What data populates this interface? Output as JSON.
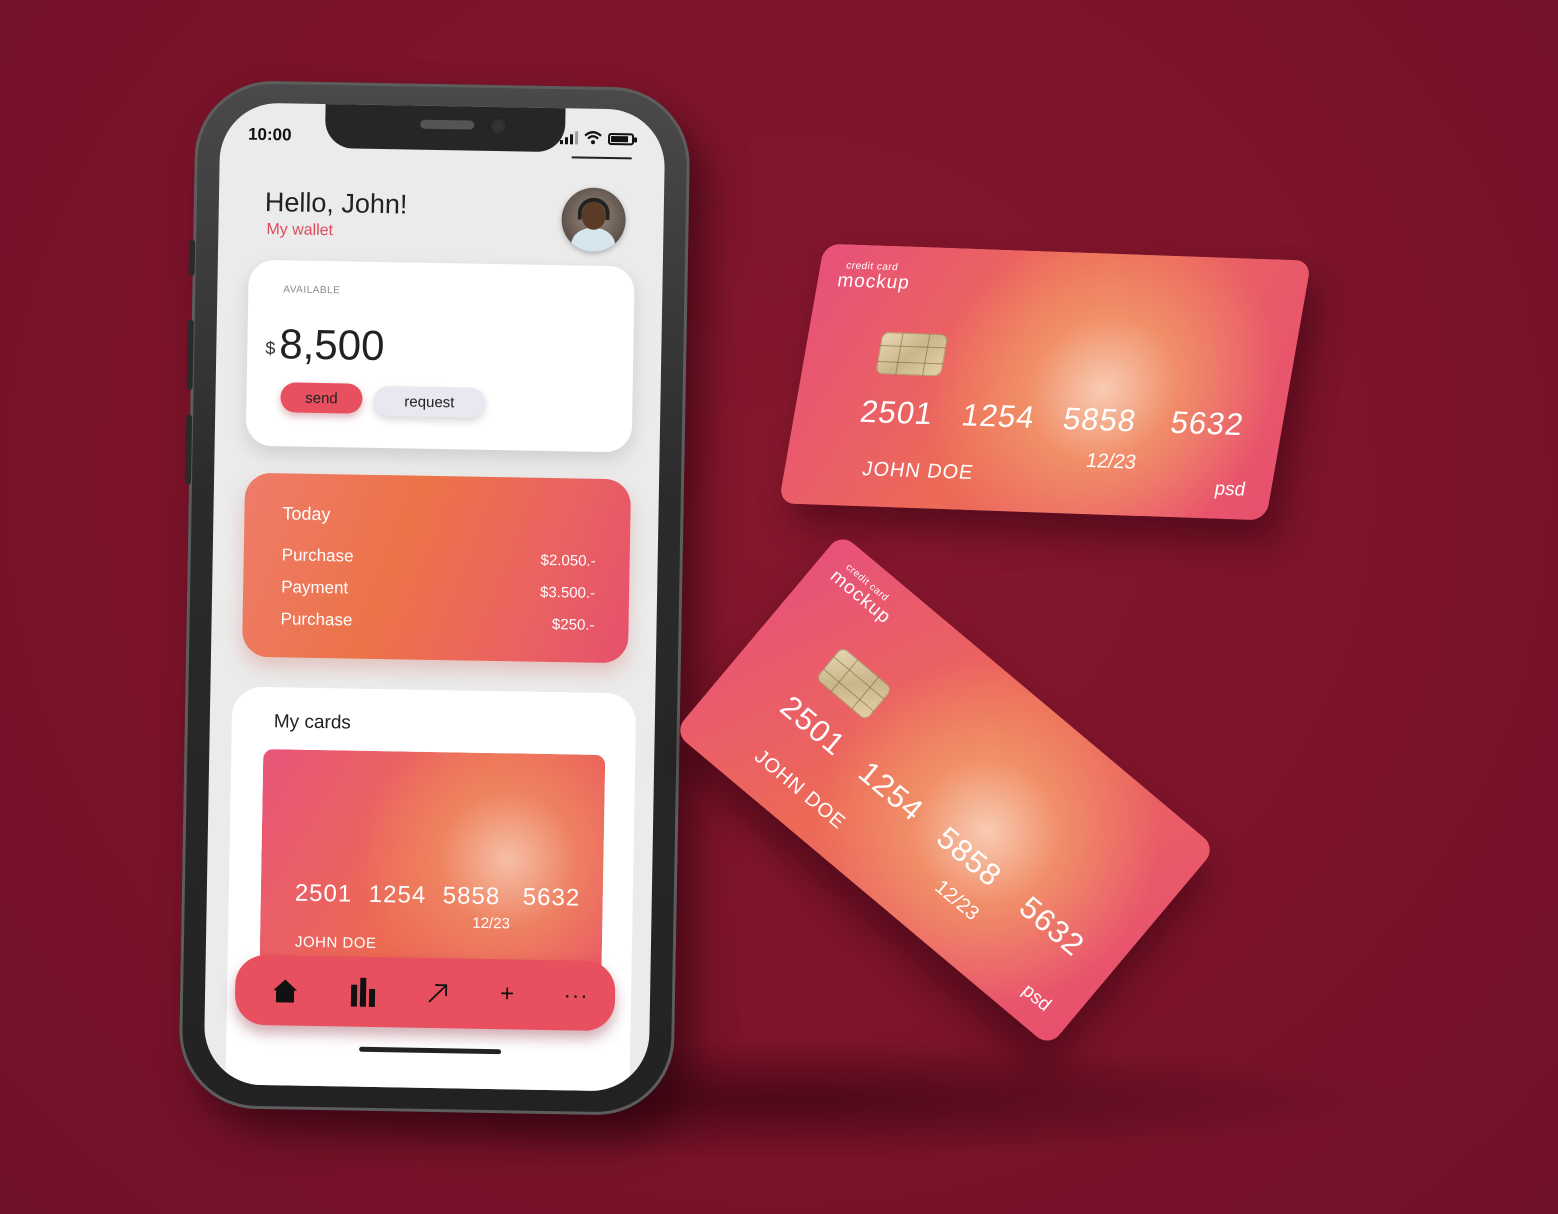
{
  "status_bar": {
    "time": "10:00"
  },
  "header": {
    "greeting": "Hello, John!",
    "subtitle": "My wallet"
  },
  "balance": {
    "label": "AVAILABLE",
    "currency": "$",
    "amount": "8,500",
    "send_label": "send",
    "request_label": "request"
  },
  "today": {
    "title": "Today",
    "rows": [
      {
        "label": "Purchase",
        "amount": "$2.050.-"
      },
      {
        "label": "Payment",
        "amount": "$3.500.-"
      },
      {
        "label": "Purchase",
        "amount": "$250.-"
      }
    ]
  },
  "my_cards": {
    "title": "My cards",
    "card": {
      "number_groups": [
        "2501",
        "1254",
        "5858",
        "5632"
      ],
      "expiry": "12/23",
      "holder": "JOHN DOE"
    }
  },
  "tab_bar": {
    "items": [
      {
        "icon": "home-icon"
      },
      {
        "icon": "bar-chart-icon"
      },
      {
        "icon": "arrow-up-right-icon"
      },
      {
        "icon": "plus-icon",
        "glyph": "+"
      },
      {
        "icon": "more-icon",
        "glyph": "···"
      }
    ]
  },
  "floating_cards": [
    {
      "brand_small": "credit card",
      "brand": "mockup",
      "number_groups": [
        "2501",
        "1254",
        "5858",
        "5632"
      ],
      "expiry": "12/23",
      "holder": "JOHN DOE",
      "maker": "psd"
    },
    {
      "brand_small": "credit card",
      "brand": "mockup",
      "number_groups": [
        "2501",
        "1254",
        "5858",
        "5632"
      ],
      "expiry": "12/23",
      "holder": "JOHN DOE",
      "maker": "psd"
    }
  ],
  "colors": {
    "background": "#7f1429",
    "accent": "#e8505f",
    "card_orange": "#ec7348",
    "screen": "#ebebeb"
  }
}
